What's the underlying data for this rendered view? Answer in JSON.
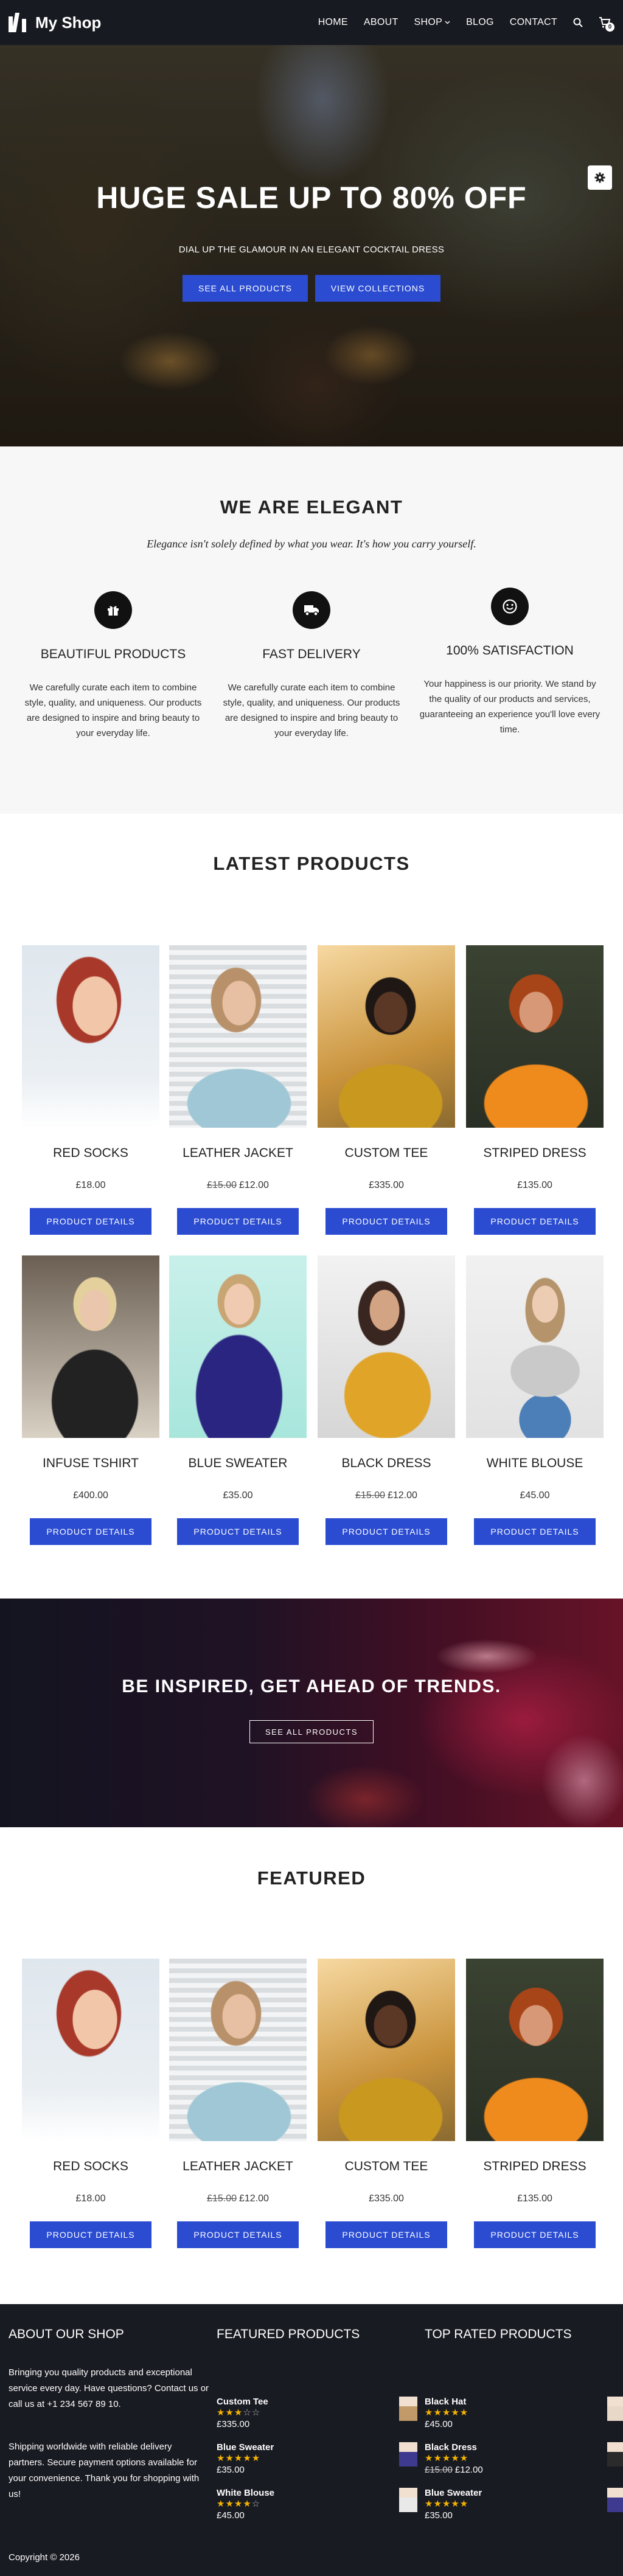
{
  "header": {
    "brand": "My Shop",
    "nav": [
      "HOME",
      "ABOUT",
      "SHOP",
      "BLOG",
      "CONTACT"
    ],
    "cart_count": "0"
  },
  "hero": {
    "title": "HUGE SALE UP TO 80% OFF",
    "subtitle": "DIAL UP THE GLAMOUR IN AN ELEGANT COCKTAIL DRESS",
    "btn_primary": "SEE ALL PRODUCTS",
    "btn_secondary": "VIEW COLLECTIONS"
  },
  "about": {
    "title": "WE ARE ELEGANT",
    "quote": "Elegance isn't solely defined by what you wear. It's how you carry yourself.",
    "features": [
      {
        "icon": "gift-icon",
        "title": "BEAUTIFUL PRODUCTS",
        "text": "We carefully curate each item to combine style, quality, and uniqueness. Our products are designed to inspire and bring beauty to your everyday life."
      },
      {
        "icon": "truck-icon",
        "title": "FAST DELIVERY",
        "text": "We carefully curate each item to combine style, quality, and uniqueness. Our products are designed to inspire and bring beauty to your everyday life."
      },
      {
        "icon": "smile-icon",
        "title": "100% SATISFACTION",
        "text": "Your happiness is our priority. We stand by the quality of our products and services, guaranteeing an experience you'll love every time."
      }
    ]
  },
  "latest": {
    "title": "LATEST PRODUCTS",
    "button_label": "PRODUCT DETAILS",
    "items": [
      {
        "name": "RED SOCKS",
        "old_price": "",
        "price": "£18.00"
      },
      {
        "name": "LEATHER JACKET",
        "old_price": "£15.00",
        "price": "£12.00"
      },
      {
        "name": "CUSTOM TEE",
        "old_price": "",
        "price": "£335.00"
      },
      {
        "name": "STRIPED DRESS",
        "old_price": "",
        "price": "£135.00"
      },
      {
        "name": "INFUSE TSHIRT",
        "old_price": "",
        "price": "£400.00"
      },
      {
        "name": "BLUE SWEATER",
        "old_price": "",
        "price": "£35.00"
      },
      {
        "name": "BLACK DRESS",
        "old_price": "£15.00",
        "price": "£12.00"
      },
      {
        "name": "WHITE BLOUSE",
        "old_price": "",
        "price": "£45.00"
      }
    ]
  },
  "banner": {
    "title": "BE INSPIRED, GET AHEAD OF TRENDS.",
    "button": "SEE ALL PRODUCTS"
  },
  "featured": {
    "title": "FEATURED",
    "button_label": "PRODUCT DETAILS",
    "items": [
      {
        "name": "RED SOCKS",
        "old_price": "",
        "price": "£18.00"
      },
      {
        "name": "LEATHER JACKET",
        "old_price": "£15.00",
        "price": "£12.00"
      },
      {
        "name": "CUSTOM TEE",
        "old_price": "",
        "price": "£335.00"
      },
      {
        "name": "STRIPED DRESS",
        "old_price": "",
        "price": "£135.00"
      }
    ]
  },
  "footer": {
    "about_heading": "ABOUT OUR SHOP",
    "about_text1": "Bringing you quality products and exceptional service every day. Have questions? Contact us or call us at +1 234 567 89 10.",
    "about_text2": "Shipping worldwide with reliable delivery partners. Secure payment options available for your convenience. Thank you for shopping with us!",
    "featured_heading": "FEATURED PRODUCTS",
    "featured_items": [
      {
        "name": "Custom Tee",
        "rating": 3,
        "price": "£335.00"
      },
      {
        "name": "Blue Sweater",
        "rating": 5,
        "price": "£35.00"
      },
      {
        "name": "White Blouse",
        "rating": 4,
        "price": "£45.00"
      }
    ],
    "top_heading": "TOP RATED PRODUCTS",
    "top_items": [
      {
        "name": "Black Hat",
        "rating": 5,
        "price": "£45.00"
      },
      {
        "name": "Black Dress",
        "rating": 5,
        "old_price": "£15.00",
        "price": "£12.00"
      },
      {
        "name": "Blue Sweater",
        "rating": 5,
        "price": "£35.00"
      }
    ],
    "copyright": "Copyright © 2026"
  },
  "colors": {
    "accent": "#2b4cd1",
    "header_bg": "#181a21",
    "footer_bg": "#191b22",
    "about_bg": "#f7f7f7",
    "star": "#f5b301"
  }
}
